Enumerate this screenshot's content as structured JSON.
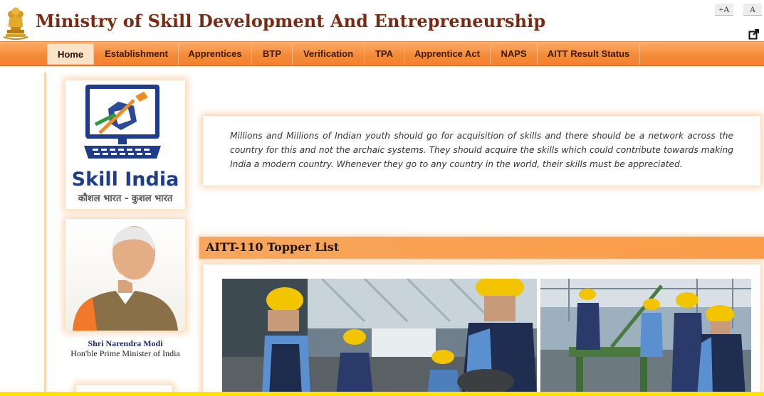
{
  "header": {
    "title": "Ministry of Skill Development And Entrepreneurship",
    "font_increase": "+A",
    "font_normal": "A",
    "external_link_icon": "external-link-icon",
    "emblem_icon": "national-emblem-icon"
  },
  "nav": {
    "items": [
      {
        "label": "Home",
        "active": true
      },
      {
        "label": "Establishment"
      },
      {
        "label": "Apprentices"
      },
      {
        "label": "BTP"
      },
      {
        "label": "Verification"
      },
      {
        "label": "TPA"
      },
      {
        "label": "Apprentice Act"
      },
      {
        "label": "NAPS"
      },
      {
        "label": "AITT Result Status"
      }
    ]
  },
  "sidebar": {
    "skill_india": {
      "logo_text": "Skill India",
      "tagline": "कौशल भारत - कुशल भारत"
    },
    "pm": {
      "name": "Shri Narendra Modi",
      "role": "Hon'ble Prime Minister of India"
    }
  },
  "quote": {
    "text": "Millions and Millions of Indian youth should go for acquisition of skills and there should be a network across the country for this and not the archaic systems. They should acquire the skills which could contribute towards making India a modern country. Whenever they go to any country in the world, their skills must be appreciated."
  },
  "topper": {
    "title": "AITT-110 Topper List"
  },
  "colors": {
    "title": "#7a2a12",
    "nav_orange": "#f48a35",
    "accent_yellow": "#ffe200"
  }
}
